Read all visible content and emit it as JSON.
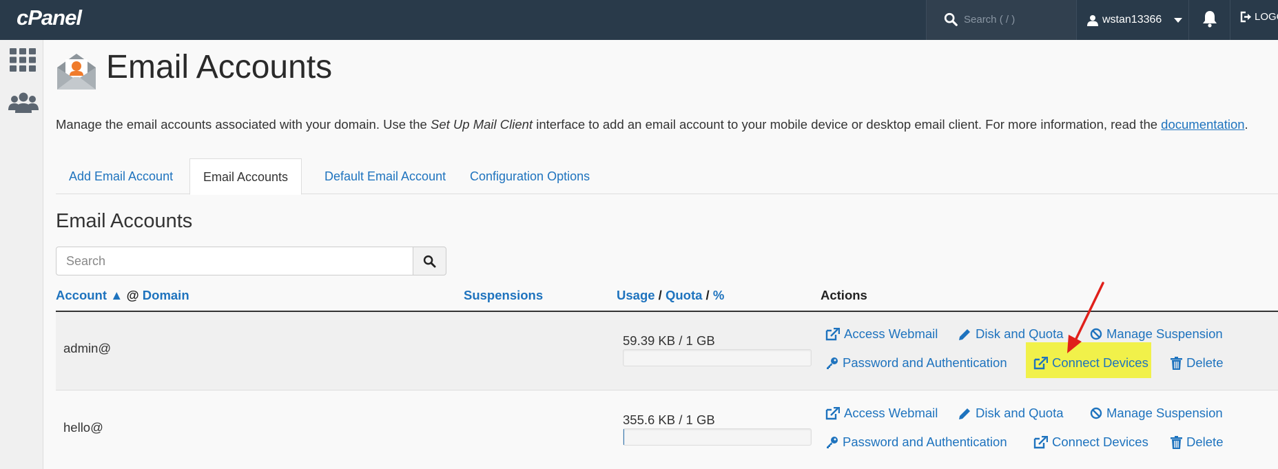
{
  "topbar": {
    "logo": "cPanel",
    "search_placeholder": "Search ( / )",
    "username": "wstan13366",
    "logout_label": "LOGOUT"
  },
  "sidebar": {
    "items": [
      {
        "icon": "grid-icon"
      },
      {
        "icon": "users-icon"
      }
    ]
  },
  "page": {
    "title": "Email Accounts",
    "intro_pre": "Manage the email accounts associated with your domain. Use the ",
    "intro_em": "Set Up Mail Client",
    "intro_mid": " interface to add an email account to your mobile device or desktop email client. For more information, read the ",
    "intro_link": "documentation",
    "intro_end": "."
  },
  "tabs": [
    {
      "label": "Add Email Account",
      "active": false
    },
    {
      "label": "Email Accounts",
      "active": true
    },
    {
      "label": "Default Email Account",
      "active": false
    },
    {
      "label": "Configuration Options",
      "active": false
    }
  ],
  "section": {
    "title": "Email Accounts",
    "search_placeholder": "Search"
  },
  "table": {
    "headers": {
      "account": "Account",
      "sort_arrow": "▲",
      "at": "@",
      "domain": "Domain",
      "suspensions": "Suspensions",
      "usage": "Usage",
      "slash1": "/",
      "quota": "Quota",
      "slash2": "/",
      "percent": "%",
      "actions": "Actions"
    },
    "rows": [
      {
        "account": "admin@",
        "usage": "59.39 KB / 1 GB",
        "usage_fraction": 0.0001,
        "actions": {
          "webmail": "Access Webmail",
          "disk": "Disk and Quota",
          "suspension": "Manage Suspension",
          "password": "Password and Authentication",
          "connect": "Connect Devices",
          "delete": "Delete"
        }
      },
      {
        "account": "hello@",
        "usage": "355.6 KB / 1 GB",
        "usage_fraction": 0.0003,
        "actions": {
          "webmail": "Access Webmail",
          "disk": "Disk and Quota",
          "suspension": "Manage Suspension",
          "password": "Password and Authentication",
          "connect": "Connect Devices",
          "delete": "Delete"
        }
      }
    ]
  },
  "colors": {
    "topbar": "#293a4a",
    "link": "#1e73be",
    "highlight": "#f1f14a",
    "annotation_arrow": "#e0201b"
  }
}
